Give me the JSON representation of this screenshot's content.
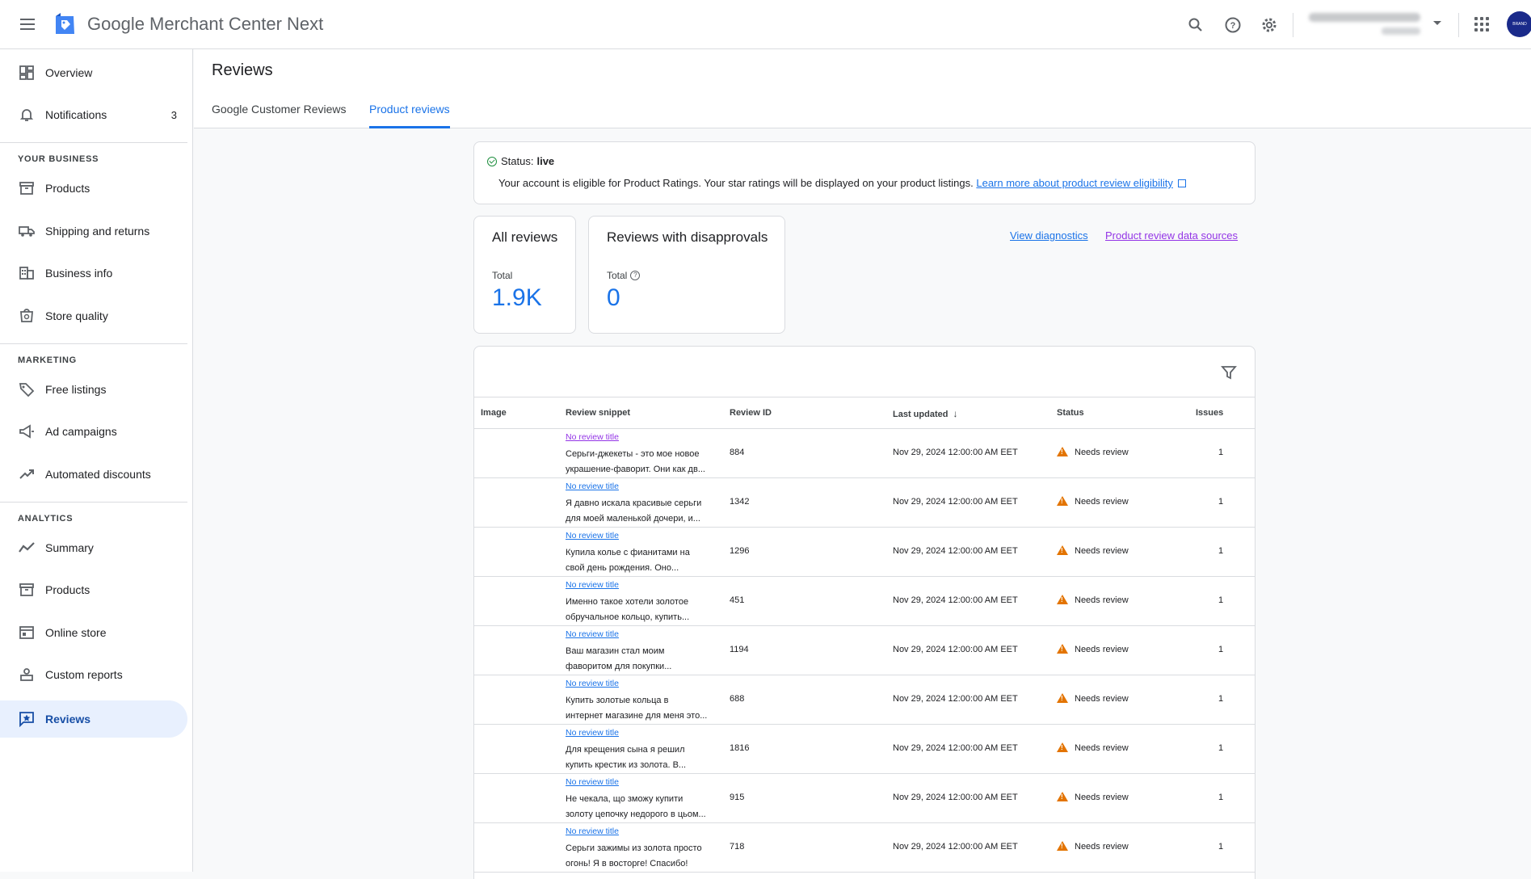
{
  "app": {
    "title": "Google Merchant Center Next",
    "account_avatar": "BRAND"
  },
  "topbar": {
    "icons": [
      "search-icon",
      "help-icon",
      "settings-icon",
      "apps-icon"
    ]
  },
  "sidebar": {
    "overview": "Overview",
    "notifications": "Notifications",
    "notifications_count": "3",
    "your_business": "YOUR BUSINESS",
    "products": "Products",
    "shipping": "Shipping and returns",
    "business_info": "Business info",
    "store_quality": "Store quality",
    "marketing": "MARKETING",
    "free_listings": "Free listings",
    "ad_campaigns": "Ad campaigns",
    "automated_discounts": "Automated discounts",
    "analytics": "ANALYTICS",
    "summary": "Summary",
    "products_analytics": "Products",
    "online_store": "Online store",
    "custom_reports": "Custom reports",
    "reviews": "Reviews"
  },
  "page": {
    "title": "Reviews",
    "tabs": [
      "Google Customer Reviews",
      "Product reviews"
    ]
  },
  "status": {
    "label": "Status:",
    "value": "live",
    "description": "Your account is eligible for Product Ratings. Your star ratings will be displayed on your product listings.",
    "link": "Learn more about product review eligibility"
  },
  "stats": {
    "all_title": "All reviews",
    "all_label": "Total",
    "all_value": "1.9K",
    "dis_title": "Reviews with disapprovals",
    "dis_label": "Total",
    "dis_value": "0"
  },
  "links": {
    "diagnostics": "View diagnostics",
    "data_sources": "Product review data sources"
  },
  "table": {
    "headers": [
      "Image",
      "Review snippet",
      "Review ID",
      "Last updated",
      "Status",
      "Issues"
    ],
    "rows": [
      {
        "title": "No review title",
        "snippet1": "Серьги-джекеты - это мое новое",
        "snippet2": "украшение-фаворит. Они как дв...",
        "id": "884",
        "updated": "Nov 29, 2024 12:00:00 AM EET",
        "status": "Needs review",
        "issues": "1"
      },
      {
        "title": "No review title",
        "snippet1": "Я давно искала красивые серьги",
        "snippet2": "для моей маленькой дочери, и...",
        "id": "1342",
        "updated": "Nov 29, 2024 12:00:00 AM EET",
        "status": "Needs review",
        "issues": "1"
      },
      {
        "title": "No review title",
        "snippet1": "Купила колье с фианитами на",
        "snippet2": "свой день рождения. Оно...",
        "id": "1296",
        "updated": "Nov 29, 2024 12:00:00 AM EET",
        "status": "Needs review",
        "issues": "1"
      },
      {
        "title": "No review title",
        "snippet1": "Именно такое хотели золотое",
        "snippet2": "обручальное кольцо, купить...",
        "id": "451",
        "updated": "Nov 29, 2024 12:00:00 AM EET",
        "status": "Needs review",
        "issues": "1"
      },
      {
        "title": "No review title",
        "snippet1": "Ваш магазин стал моим",
        "snippet2": "фаворитом для покупки...",
        "id": "1194",
        "updated": "Nov 29, 2024 12:00:00 AM EET",
        "status": "Needs review",
        "issues": "1"
      },
      {
        "title": "No review title",
        "snippet1": "Купить золотые кольца в",
        "snippet2": "интернет магазине для меня это...",
        "id": "688",
        "updated": "Nov 29, 2024 12:00:00 AM EET",
        "status": "Needs review",
        "issues": "1"
      },
      {
        "title": "No review title",
        "snippet1": "Для крещения сына я решил",
        "snippet2": "купить крестик из золота. В...",
        "id": "1816",
        "updated": "Nov 29, 2024 12:00:00 AM EET",
        "status": "Needs review",
        "issues": "1"
      },
      {
        "title": "No review title",
        "snippet1": "Не чекала, що зможу купити",
        "snippet2": "золоту цепочку недорого в цьом...",
        "id": "915",
        "updated": "Nov 29, 2024 12:00:00 AM EET",
        "status": "Needs review",
        "issues": "1"
      },
      {
        "title": "No review title",
        "snippet1": "Серьги зажимы из золота просто",
        "snippet2": "огонь! Я в восторге! Спасибо!",
        "id": "718",
        "updated": "Nov 29, 2024 12:00:00 AM EET",
        "status": "Needs review",
        "issues": "1"
      }
    ]
  }
}
